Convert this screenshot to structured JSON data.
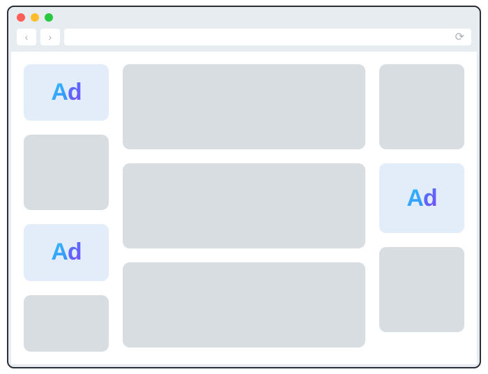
{
  "titlebar": {
    "dots": [
      {
        "color": "#ff5f57"
      },
      {
        "color": "#ffbd2e"
      },
      {
        "color": "#28c940"
      }
    ]
  },
  "toolbar": {
    "back_glyph": "‹",
    "forward_glyph": "›",
    "reload_glyph": "⟳",
    "address_value": ""
  },
  "ad_label": "Ad",
  "layout": {
    "left": [
      {
        "type": "ad"
      },
      {
        "type": "block"
      },
      {
        "type": "ad"
      },
      {
        "type": "block"
      }
    ],
    "mid": [
      {
        "type": "block"
      },
      {
        "type": "block"
      },
      {
        "type": "block"
      }
    ],
    "right": [
      {
        "type": "block"
      },
      {
        "type": "ad"
      },
      {
        "type": "block"
      }
    ]
  }
}
